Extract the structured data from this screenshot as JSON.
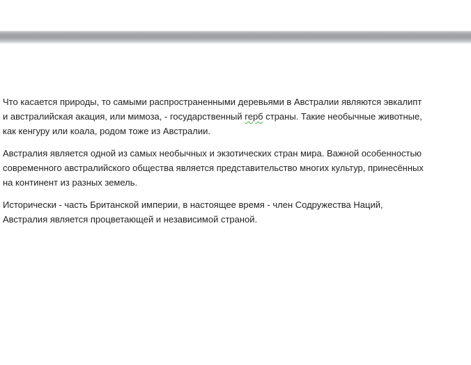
{
  "document": {
    "paragraphs": [
      {
        "before": "Что касается природы, то самыми распространенными деревьями в Австралии являются эвкалипт\nи австралийская акация, или мимоза, - государственный ",
        "flagged_word": "герб",
        "after": " страны. Такие необычные животные,\nкак кенгуру или коала, родом тоже из Австралии."
      },
      {
        "text": "Австралия является одной из самых необычных и экзотических стран мира. Важной особенностью\nсовременного австралийского общества является представительство многих культур, принесённых\nна континент из разных земель."
      },
      {
        "text": "Исторически - часть Британской империи, в настоящее время - член Содружества Наций,\nАвстралия является процветающей и независимой страной."
      }
    ]
  }
}
